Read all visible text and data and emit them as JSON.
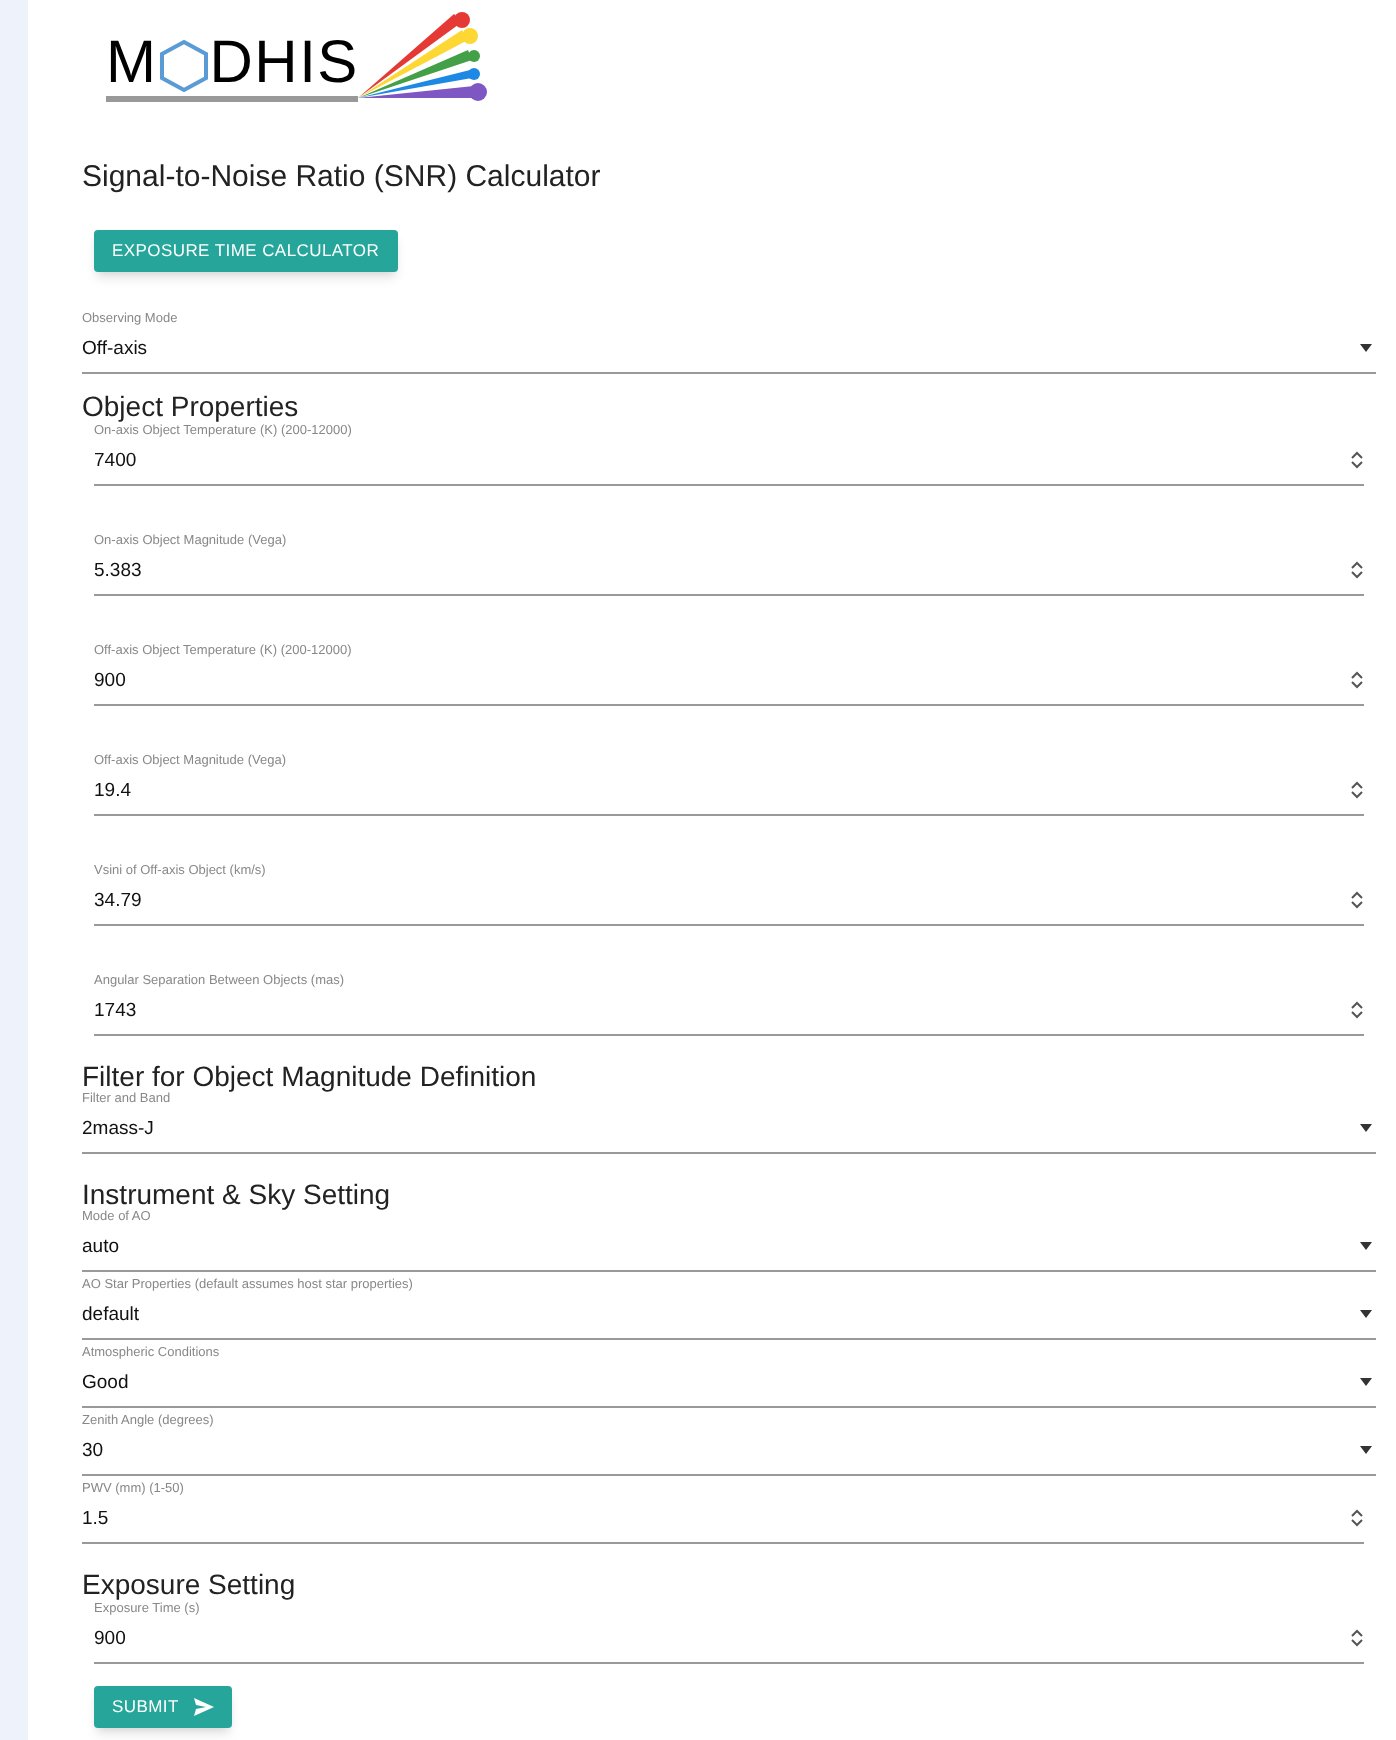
{
  "logo": {
    "text_before": "M",
    "text_after": "DHIS"
  },
  "title": "Signal-to-Noise Ratio (SNR) Calculator",
  "mode_button": "EXPOSURE TIME CALCULATOR",
  "top_fields": [
    {
      "kind": "select",
      "label": "Observing Mode",
      "value": "Off-axis"
    }
  ],
  "sections": [
    {
      "heading": "Object Properties",
      "fields": [
        {
          "kind": "number",
          "label": "On-axis Object Temperature (K) (200-12000)",
          "value": "7400"
        },
        {
          "kind": "number",
          "label": "On-axis Object Magnitude (Vega)",
          "value": "5.383"
        },
        {
          "kind": "number",
          "label": "Off-axis Object Temperature (K) (200-12000)",
          "value": "900"
        },
        {
          "kind": "number",
          "label": "Off-axis Object Magnitude (Vega)",
          "value": "19.4"
        },
        {
          "kind": "number",
          "label": "Vsini of Off-axis Object (km/s)",
          "value": "34.79"
        },
        {
          "kind": "number",
          "label": "Angular Separation Between Objects (mas)",
          "value": "1743"
        }
      ]
    },
    {
      "heading": "Filter for Object Magnitude Definition",
      "fields": [
        {
          "kind": "select",
          "label": "Filter and Band",
          "value": "2mass-J"
        }
      ]
    },
    {
      "heading": "Instrument & Sky Setting",
      "fields": [
        {
          "kind": "select",
          "label": "Mode of AO",
          "value": "auto"
        },
        {
          "kind": "select",
          "label": "AO Star Properties (default assumes host star properties)",
          "value": "default"
        },
        {
          "kind": "select",
          "label": "Atmospheric Conditions",
          "value": "Good"
        },
        {
          "kind": "select",
          "label": "Zenith Angle (degrees)",
          "value": "30"
        },
        {
          "kind": "number",
          "label": "PWV (mm) (1-50)",
          "value": "1.5"
        }
      ]
    },
    {
      "heading": "Exposure Setting",
      "fields": [
        {
          "kind": "number",
          "label": "Exposure Time (s)",
          "value": "900"
        }
      ]
    }
  ],
  "submit_button": "SUBMIT"
}
